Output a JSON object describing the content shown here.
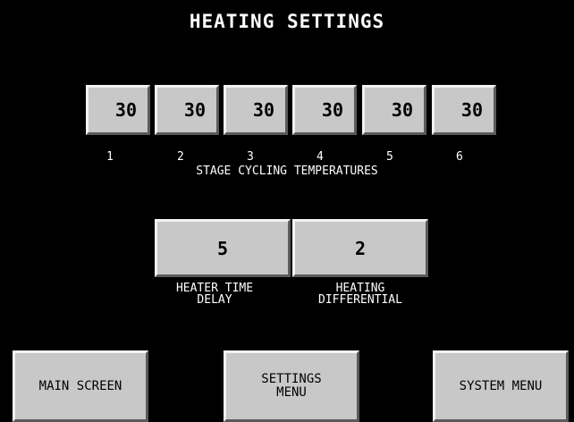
{
  "title": "HEATING SETTINGS",
  "stages": [
    {
      "value": "30",
      "number": "1"
    },
    {
      "value": "30",
      "number": "2"
    },
    {
      "value": "30",
      "number": "3"
    },
    {
      "value": "30",
      "number": "4"
    },
    {
      "value": "30",
      "number": "5"
    },
    {
      "value": "30",
      "number": "6"
    }
  ],
  "stage_caption": "STAGE CYCLING TEMPERATURES",
  "heater_time_delay": {
    "value": "5",
    "label": "HEATER TIME\nDELAY"
  },
  "heating_differential": {
    "value": "2",
    "label": "HEATING\nDIFFERENTIAL"
  },
  "nav": {
    "main_screen": "MAIN SCREEN",
    "settings_menu": "SETTINGS\nMENU",
    "system_menu": "SYSTEM MENU"
  },
  "colors": {
    "background": "#000000",
    "button_face": "#c8c8c8",
    "text": "#ffffff"
  }
}
